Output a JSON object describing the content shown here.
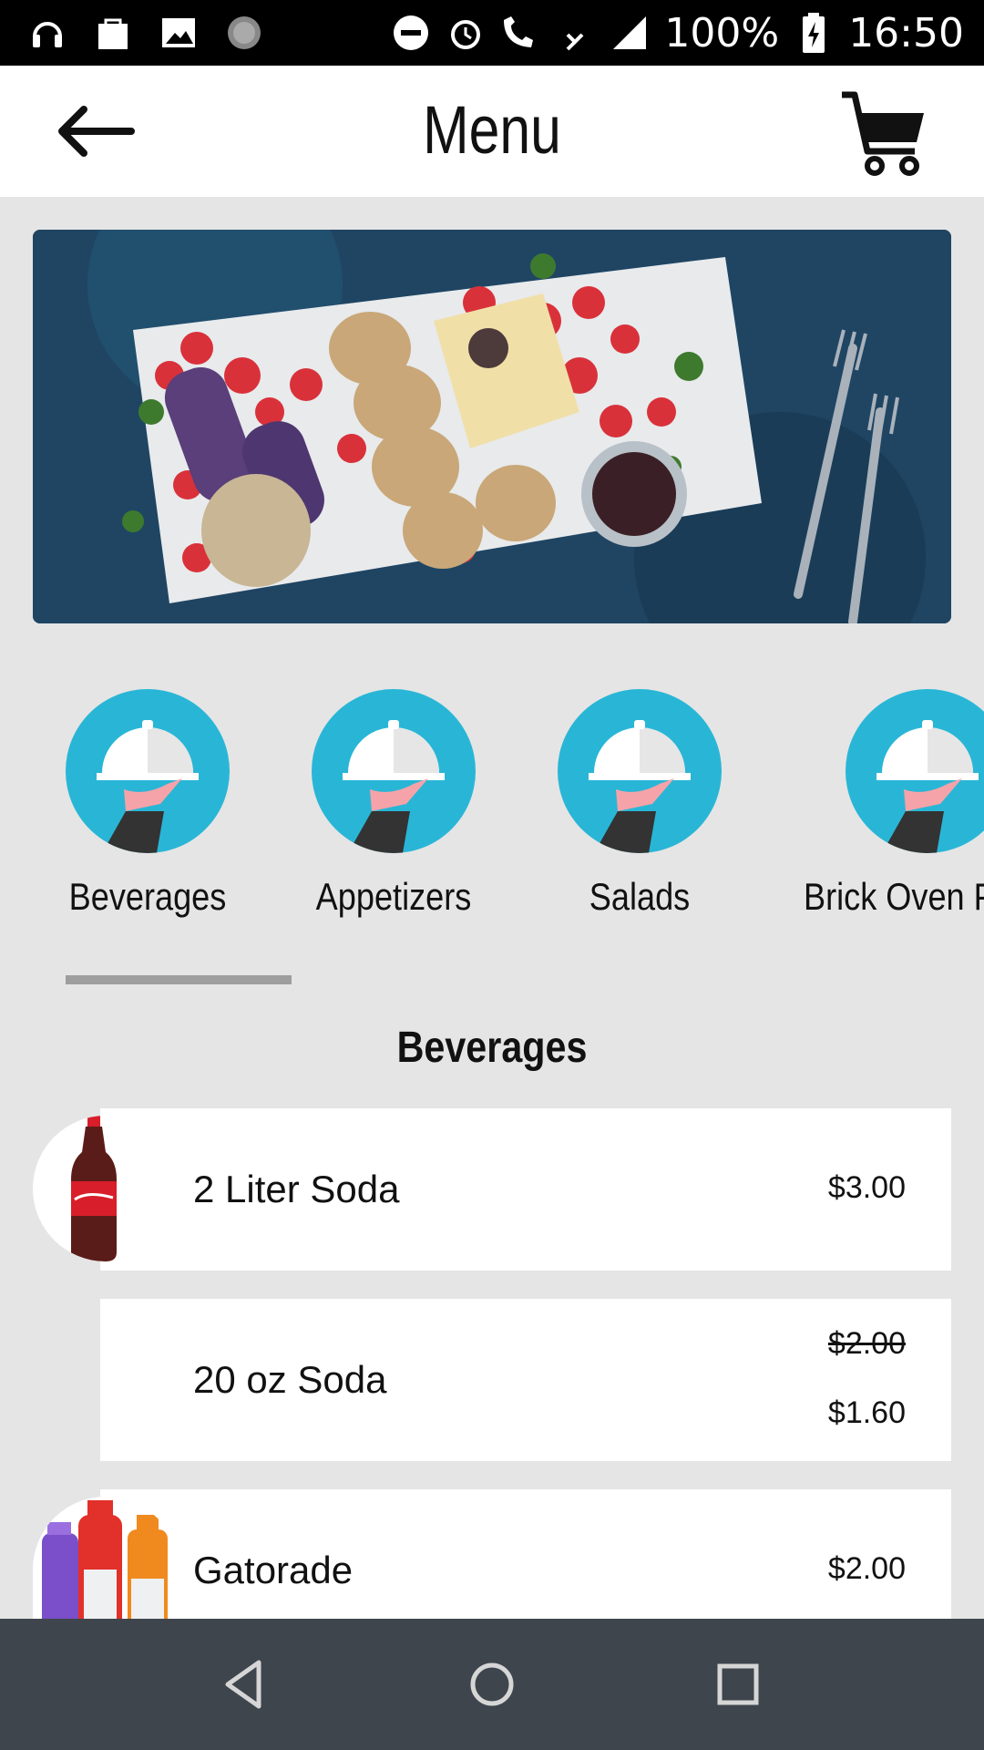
{
  "status_bar": {
    "battery": "100%",
    "time": "16:50",
    "icons": [
      "headset-icon",
      "shopping-bag-icon",
      "image-icon",
      "spinner-icon",
      "do-not-disturb-icon",
      "alarm-icon",
      "lte-call-icon",
      "lte-data-icon",
      "signal-icon",
      "battery-icon"
    ]
  },
  "toolbar": {
    "title": "Menu",
    "back_icon": "arrow-left-icon",
    "cart_icon": "cart-icon"
  },
  "hero": {
    "icon": "food-platter-image"
  },
  "categories": [
    {
      "label": "Beverages"
    },
    {
      "label": "Appetizers"
    },
    {
      "label": "Salads"
    },
    {
      "label": "Brick Oven P"
    }
  ],
  "section": {
    "title": "Beverages"
  },
  "items": [
    {
      "name": "2 Liter Soda",
      "price": "$3.00"
    },
    {
      "name": "20 oz Soda",
      "old_price": "$2.00",
      "price": "$1.60"
    },
    {
      "name": "Gatorade",
      "price": "$2.00"
    }
  ],
  "colors": {
    "accent": "#29b6d6",
    "navbar": "#3f454c",
    "background": "#e5e5e5"
  }
}
